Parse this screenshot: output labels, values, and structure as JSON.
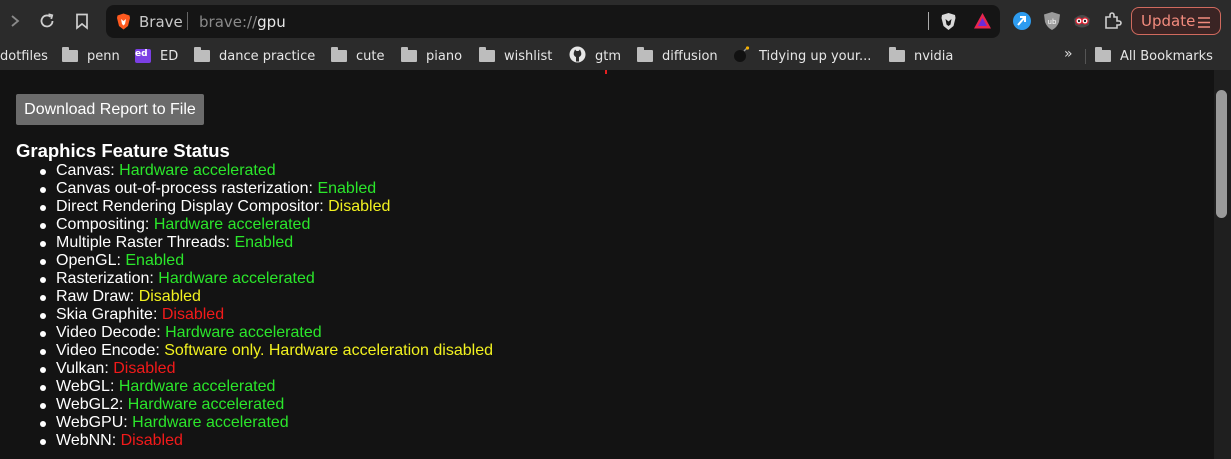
{
  "window": {
    "title": "brave://gpu"
  },
  "toolbar": {
    "site_name": "Brave",
    "url_scheme": "brave://",
    "url_host": "gpu",
    "update_label": "Update",
    "icons": [
      "forward-icon",
      "reload-icon",
      "bookmark-icon",
      "brave-shield-icon",
      "brave-rewards-icon",
      "extension-blue-icon",
      "ublock-icon",
      "privacy-badger-icon",
      "extensions-icon",
      "menu-icon"
    ]
  },
  "bookmarks": {
    "items": [
      {
        "label": "dotfiles",
        "icon": "none"
      },
      {
        "label": "penn",
        "icon": "folder"
      },
      {
        "label": "ED",
        "icon": "ed"
      },
      {
        "label": "dance practice",
        "icon": "folder"
      },
      {
        "label": "cute",
        "icon": "folder"
      },
      {
        "label": "piano",
        "icon": "folder"
      },
      {
        "label": "wishlist",
        "icon": "folder"
      },
      {
        "label": "gtm",
        "icon": "github"
      },
      {
        "label": "diffusion",
        "icon": "folder"
      },
      {
        "label": "Tidying up your...",
        "icon": "bomb"
      },
      {
        "label": "nvidia",
        "icon": "folder"
      }
    ],
    "more": "»",
    "all_label": "All Bookmarks",
    "ed_text": "ed"
  },
  "content": {
    "download_button": "Download Report to File",
    "section_title": "Graphics Feature Status",
    "features": [
      {
        "name": "Canvas: ",
        "status": "Hardware accelerated",
        "color": "#2be62b"
      },
      {
        "name": "Canvas out-of-process rasterization: ",
        "status": "Enabled",
        "color": "#2be62b"
      },
      {
        "name": "Direct Rendering Display Compositor: ",
        "status": "Disabled",
        "color": "#f2f220"
      },
      {
        "name": "Compositing: ",
        "status": "Hardware accelerated",
        "color": "#2be62b"
      },
      {
        "name": "Multiple Raster Threads: ",
        "status": "Enabled",
        "color": "#2be62b"
      },
      {
        "name": "OpenGL: ",
        "status": "Enabled",
        "color": "#2be62b"
      },
      {
        "name": "Rasterization: ",
        "status": "Hardware accelerated",
        "color": "#2be62b"
      },
      {
        "name": "Raw Draw: ",
        "status": "Disabled",
        "color": "#f2f220"
      },
      {
        "name": "Skia Graphite: ",
        "status": "Disabled",
        "color": "#f21a1a"
      },
      {
        "name": "Video Decode: ",
        "status": "Hardware accelerated",
        "color": "#2be62b"
      },
      {
        "name": "Video Encode: ",
        "status": "Software only. Hardware acceleration disabled",
        "color": "#f2f220"
      },
      {
        "name": "Vulkan: ",
        "status": "Disabled",
        "color": "#f21a1a"
      },
      {
        "name": "WebGL: ",
        "status": "Hardware accelerated",
        "color": "#2be62b"
      },
      {
        "name": "WebGL2: ",
        "status": "Hardware accelerated",
        "color": "#2be62b"
      },
      {
        "name": "WebGPU: ",
        "status": "Hardware accelerated",
        "color": "#2be62b"
      },
      {
        "name": "WebNN: ",
        "status": "Disabled",
        "color": "#f21a1a"
      }
    ]
  }
}
